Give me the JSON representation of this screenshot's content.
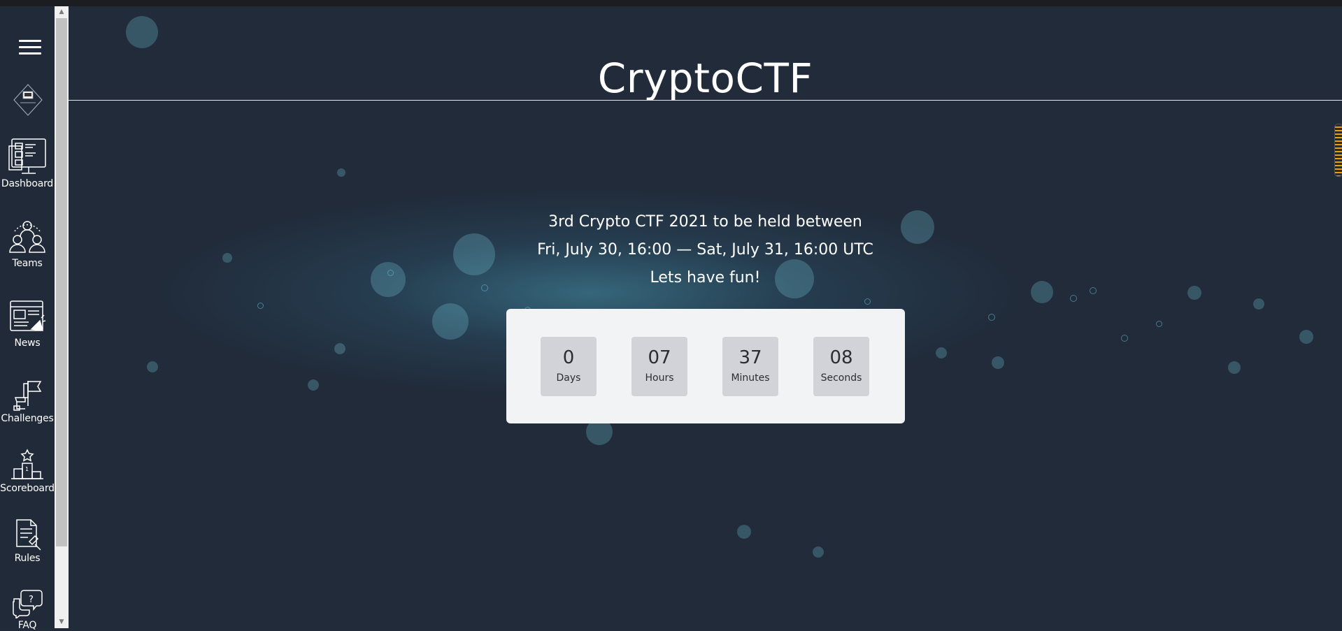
{
  "site": {
    "title": "CryptoCTF"
  },
  "sidebar": {
    "items": [
      {
        "label": "Dashboard",
        "icon": "dashboard-icon"
      },
      {
        "label": "Teams",
        "icon": "teams-icon"
      },
      {
        "label": "News",
        "icon": "news-icon"
      },
      {
        "label": "Challenges",
        "icon": "challenges-icon"
      },
      {
        "label": "Scoreboard",
        "icon": "scoreboard-icon"
      },
      {
        "label": "Rules",
        "icon": "rules-icon"
      },
      {
        "label": "FAQ",
        "icon": "faq-icon"
      }
    ]
  },
  "intro": {
    "line1": "3rd Crypto CTF 2021 to be held between",
    "line2": "Fri, July 30, 16:00 — Sat, July 31, 16:00 UTC",
    "line3": "Lets have fun!"
  },
  "countdown": {
    "days": {
      "value": "0",
      "unit": "Days"
    },
    "hours": {
      "value": "07",
      "unit": "Hours"
    },
    "minutes": {
      "value": "37",
      "unit": "Minutes"
    },
    "seconds": {
      "value": "08",
      "unit": "Seconds"
    }
  },
  "colors": {
    "background": "#212b3a",
    "countdown_panel": "#f2f3f5",
    "countdown_box": "#d1d3d8",
    "accent_bubble": "#64bed7"
  }
}
